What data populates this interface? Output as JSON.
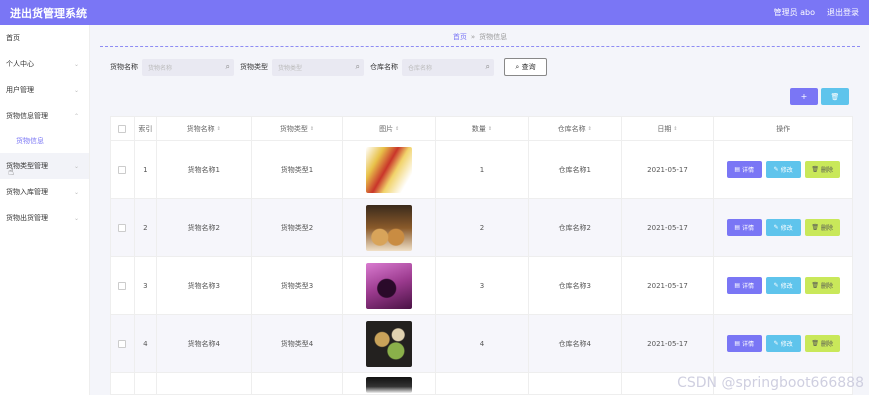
{
  "app": {
    "title": "进出货管理系统",
    "user_label": "管理员 abo",
    "logout": "退出登录"
  },
  "sidebar": {
    "items": [
      {
        "label": "首页"
      },
      {
        "label": "个人中心"
      },
      {
        "label": "用户管理"
      },
      {
        "label": "货物信息管理",
        "sub": "货物信息"
      },
      {
        "label": "货物类型管理"
      },
      {
        "label": "货物入库管理"
      },
      {
        "label": "货物出货管理"
      }
    ]
  },
  "breadcrumb": {
    "home": "首页",
    "sep": "»",
    "current": "货物信息"
  },
  "search": {
    "name_label": "货物名称",
    "name_placeholder": "货物名称",
    "type_label": "货物类型",
    "type_placeholder": "货物类型",
    "warehouse_label": "仓库名称",
    "warehouse_placeholder": "仓库名称",
    "query_button": "查询"
  },
  "toolbar": {
    "add_icon": "+",
    "delete_icon": "🗑"
  },
  "table": {
    "headers": [
      "索引",
      "货物名称",
      "货物类型",
      "图片",
      "数量",
      "仓库名称",
      "日期",
      "操作"
    ],
    "rows": [
      {
        "index": "1",
        "name": "货物名称1",
        "type": "货物类型1",
        "qty": "1",
        "warehouse": "仓库名称1",
        "date": "2021-05-17"
      },
      {
        "index": "2",
        "name": "货物名称2",
        "type": "货物类型2",
        "qty": "2",
        "warehouse": "仓库名称2",
        "date": "2021-05-17"
      },
      {
        "index": "3",
        "name": "货物名称3",
        "type": "货物类型3",
        "qty": "3",
        "warehouse": "仓库名称3",
        "date": "2021-05-17"
      },
      {
        "index": "4",
        "name": "货物名称4",
        "type": "货物类型4",
        "qty": "4",
        "warehouse": "仓库名称4",
        "date": "2021-05-17"
      }
    ],
    "actions": {
      "detail": "详情",
      "edit": "修改",
      "delete": "删除"
    }
  },
  "watermark": "CSDN @springboot666888"
}
